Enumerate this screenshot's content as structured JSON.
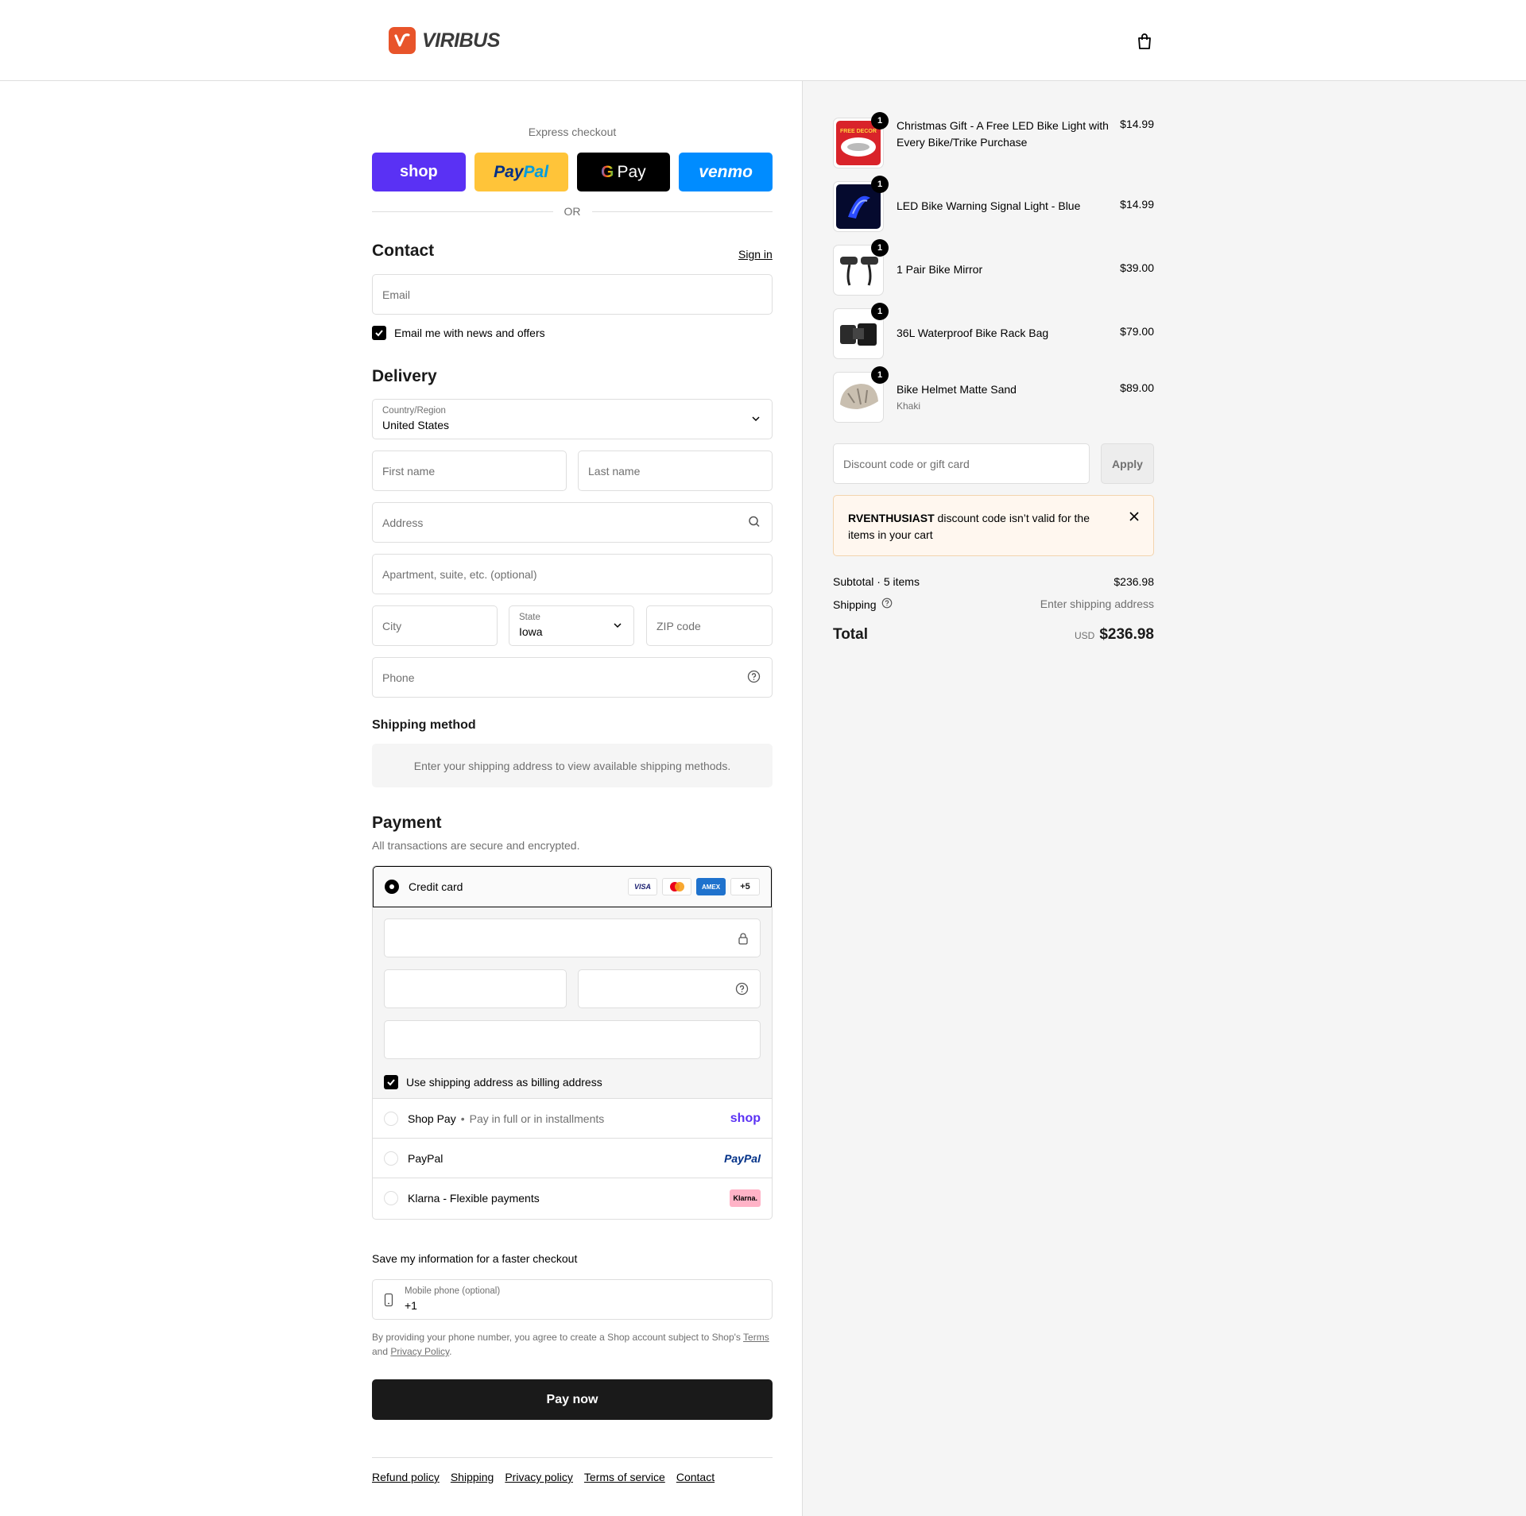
{
  "header": {
    "brand": "VIRIBUS",
    "cart_icon": "shopping-bag-icon"
  },
  "express": {
    "title": "Express checkout",
    "buttons": [
      "shop",
      "PayPal",
      "Pay",
      "venmo"
    ],
    "or": "OR"
  },
  "contact": {
    "title": "Contact",
    "sign_in": "Sign in",
    "email_placeholder": "Email",
    "newsletter_label": "Email me with news and offers",
    "newsletter_checked": true
  },
  "delivery": {
    "title": "Delivery",
    "country_label": "Country/Region",
    "country_value": "United States",
    "first_name_placeholder": "First name",
    "last_name_placeholder": "Last name",
    "address_placeholder": "Address",
    "apartment_placeholder": "Apartment, suite, etc. (optional)",
    "city_placeholder": "City",
    "state_label": "State",
    "state_value": "Iowa",
    "zip_placeholder": "ZIP code",
    "phone_placeholder": "Phone"
  },
  "shipping_method": {
    "title": "Shipping method",
    "info": "Enter your shipping address to view available shipping methods."
  },
  "payment": {
    "title": "Payment",
    "subtitle": "All transactions are secure and encrypted.",
    "credit_card_label": "Credit card",
    "card_brands": [
      "VISA",
      "Mastercard",
      "AMEX",
      "+5"
    ],
    "billing_same_label": "Use shipping address as billing address",
    "billing_same_checked": true,
    "options": [
      {
        "label": "Shop Pay",
        "sub": "Pay in full or in installments",
        "logo": "shop"
      },
      {
        "label": "PayPal",
        "sub": "",
        "logo": "PayPal"
      },
      {
        "label": "Klarna - Flexible payments",
        "sub": "",
        "logo": "Klarna."
      }
    ]
  },
  "save_info": {
    "title": "Save my information for a faster checkout",
    "mobile_label": "Mobile phone (optional)",
    "mobile_value": "+1",
    "legal_prefix": "By providing your phone number, you agree to create a Shop account subject to Shop's",
    "terms": "Terms",
    "and": "and",
    "privacy": "Privacy Policy",
    "period": "."
  },
  "pay_now": "Pay now",
  "footer": [
    "Refund policy",
    "Shipping",
    "Privacy policy",
    "Terms of service",
    "Contact"
  ],
  "cart": {
    "items": [
      {
        "name": "Christmas Gift - A Free LED Bike Light with Every Bike/Trike Purchase",
        "variant": "",
        "price": "$14.99",
        "qty": "1"
      },
      {
        "name": "LED Bike Warning Signal Light - Blue",
        "variant": "",
        "price": "$14.99",
        "qty": "1"
      },
      {
        "name": "1 Pair Bike Mirror",
        "variant": "",
        "price": "$39.00",
        "qty": "1"
      },
      {
        "name": "36L Waterproof Bike Rack Bag",
        "variant": "",
        "price": "$79.00",
        "qty": "1"
      },
      {
        "name": "Bike Helmet Matte Sand",
        "variant": "Khaki",
        "price": "$89.00",
        "qty": "1"
      }
    ],
    "discount_placeholder": "Discount code or gift card",
    "apply": "Apply",
    "alert_code": "RVENTHUSIAST",
    "alert_text": " discount code isn’t valid for the items in your cart",
    "subtotal_label": "Subtotal · 5 items",
    "subtotal_value": "$236.98",
    "shipping_label": "Shipping",
    "shipping_value": "Enter shipping address",
    "total_label": "Total",
    "currency": "USD",
    "total_value": "$236.98"
  },
  "colors": {
    "shop": "#5a31f4",
    "paypal": "#ffc439",
    "venmo": "#008cff",
    "brand": "#e8542a"
  }
}
